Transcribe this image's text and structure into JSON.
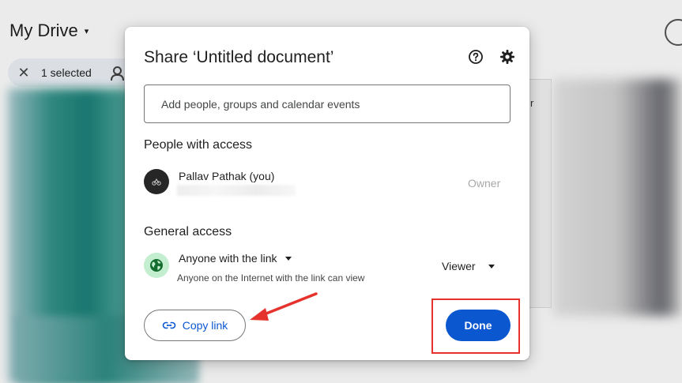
{
  "background": {
    "page_title": "My Drive",
    "caret": "▾",
    "selection_bar": {
      "close_glyph": "✕",
      "selected_text": "1 selected"
    },
    "side_card_char": "r"
  },
  "dialog": {
    "title": "Share ‘Untitled document’",
    "icons": [
      "help-icon",
      "settings-gear-icon"
    ],
    "add_people": {
      "placeholder": "Add people, groups and calendar events",
      "value": ""
    },
    "people_section": {
      "heading": "People with access",
      "people": [
        {
          "name": "Pallav Pathak (you)",
          "role": "Owner",
          "avatar": "avatar-icon"
        }
      ]
    },
    "general_access": {
      "heading": "General access",
      "access_level": "Anyone with the link",
      "access_description": "Anyone on the Internet with the link can view",
      "role": "Viewer",
      "icon": "globe-icon"
    },
    "buttons": {
      "copy_link": "Copy link",
      "copy_icon": "link-icon",
      "done": "Done"
    }
  },
  "colors": {
    "primary_blue": "#0b57d0",
    "annotation_red": "#e5322d",
    "globe_bg": "#c4eed0",
    "globe_fg": "#146c2e"
  }
}
